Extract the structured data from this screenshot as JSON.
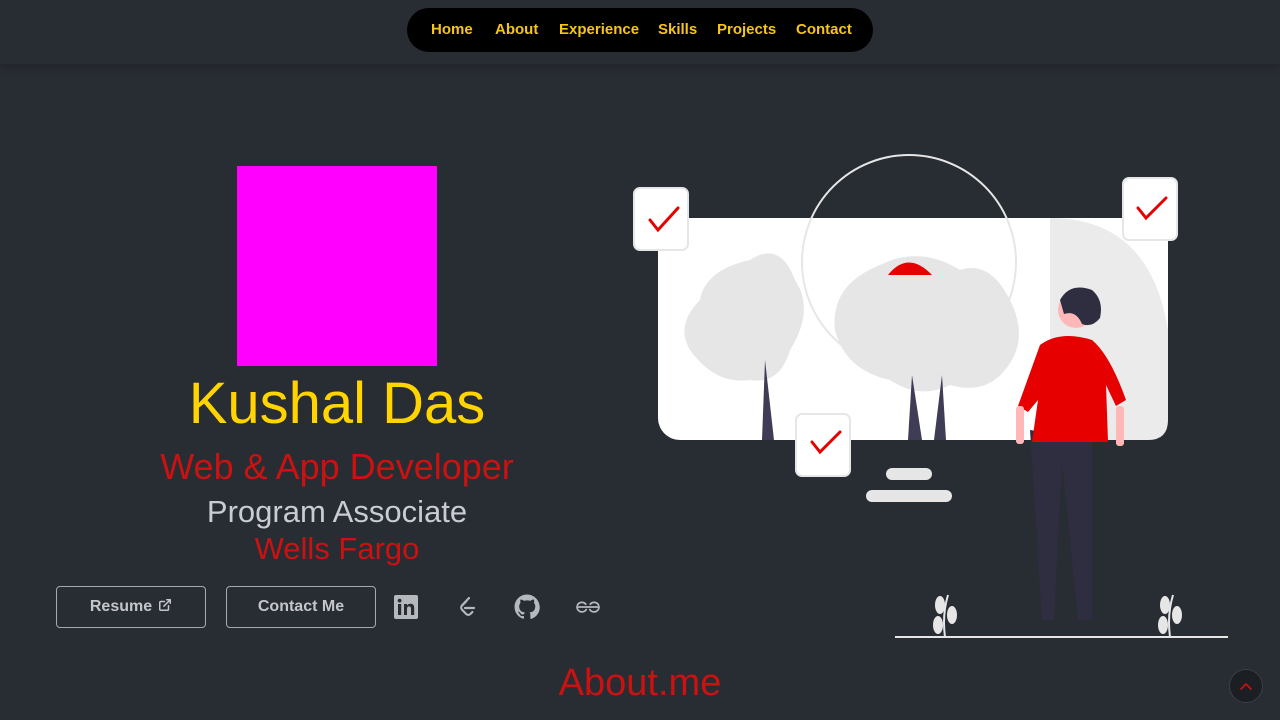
{
  "nav": {
    "items": [
      {
        "label": "Home"
      },
      {
        "label": "About"
      },
      {
        "label": "Experience"
      },
      {
        "label": "Skills"
      },
      {
        "label": "Projects"
      },
      {
        "label": "Contact"
      }
    ]
  },
  "hero": {
    "name": "Kushal Das",
    "role": "Web & App Developer",
    "position": "Program Associate",
    "company": "Wells Fargo",
    "resume_label": "Resume",
    "contact_label": "Contact Me",
    "social": [
      "linkedin-icon",
      "leetcode-icon",
      "github-icon",
      "geeksforgeeks-icon"
    ]
  },
  "about": {
    "heading": "About.me"
  },
  "colors": {
    "background": "#282c33",
    "nav_bg": "#000000",
    "nav_text": "#f5c518",
    "name": "#ffd400",
    "accent_red": "#cc1111",
    "avatar": "#ff00ff"
  }
}
